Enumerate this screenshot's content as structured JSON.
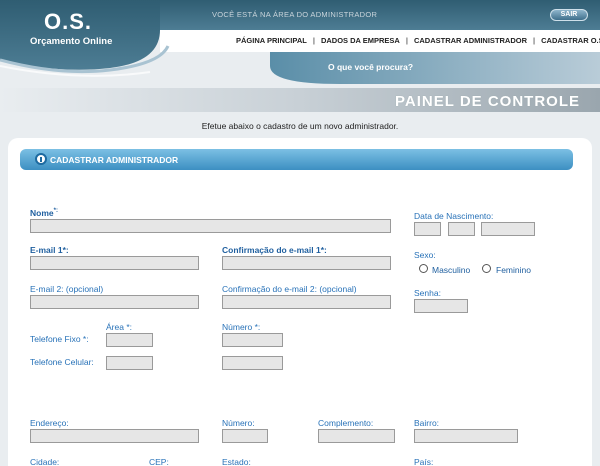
{
  "header": {
    "logo_title": "O.S.",
    "logo_subtitle": "Orçamento Online",
    "admin_area_notice": "VOCÊ ESTÁ NA ÁREA DO ADMINISTRADOR",
    "logout_label": "SAIR",
    "nav": [
      "PÁGINA PRINCIPAL",
      "DADOS DA EMPRESA",
      "CADASTRAR ADMINISTRADOR",
      "CADASTRAR O.S."
    ],
    "nav_separator": "|",
    "search_hint": "O que você procura?"
  },
  "panel_title": "PAINEL DE CONTROLE",
  "instruction": "Efetue abaixo o cadastro de um novo administrador.",
  "section_title": "CADASTRAR ADMINISTRADOR",
  "form": {
    "nome_label": "Nome",
    "nome_req": "*:",
    "data_nasc_label": "Data de Nascimento:",
    "email1_label": "E-mail 1*:",
    "conf_email1_label": "Confirmação do e-mail 1*:",
    "sexo_label": "Sexo:",
    "sexo_options": [
      "Masculino",
      "Feminino"
    ],
    "email2_label": "E-mail 2: (opcional)",
    "conf_email2_label": "Confirmação do e-mail 2: (opcional)",
    "senha_label": "Senha:",
    "area_label": "Área *:",
    "numero_tel_label": "Número *:",
    "tel_fixo_label": "Telefone Fixo *:",
    "tel_cel_label": "Telefone Celular:",
    "endereco_label": "Endereço:",
    "numero_label": "Número:",
    "complemento_label": "Complemento:",
    "bairro_label": "Bairro:",
    "cidade_label": "Cidade:",
    "cep_label": "CEP:",
    "estado_label": "Estado:",
    "pais_label": "País:"
  },
  "colors": {
    "accent": "#3c8fc2",
    "header_dark": "#2e5a6e",
    "label_blue": "#2872b8"
  }
}
